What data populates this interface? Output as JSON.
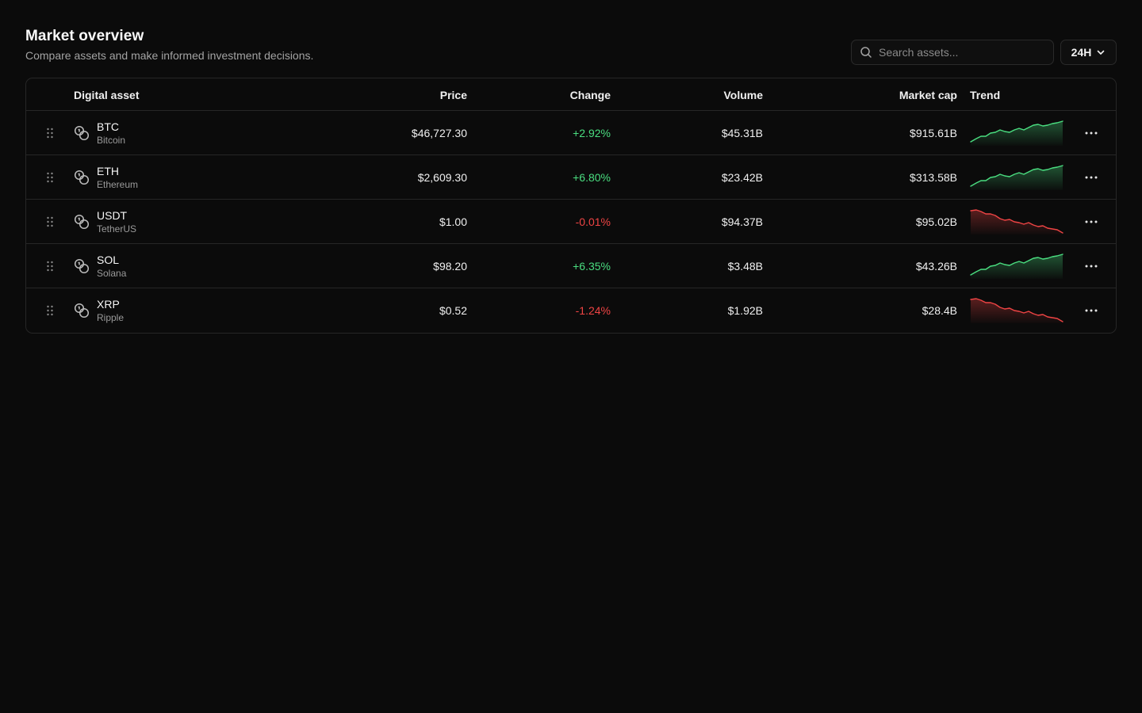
{
  "header": {
    "title": "Market overview",
    "subtitle": "Compare assets and make informed investment decisions."
  },
  "search": {
    "placeholder": "Search assets..."
  },
  "period": {
    "selected": "24H"
  },
  "table": {
    "columns": {
      "asset": "Digital asset",
      "price": "Price",
      "change": "Change",
      "volume": "Volume",
      "market_cap": "Market cap",
      "trend": "Trend"
    },
    "rows": [
      {
        "symbol": "BTC",
        "name": "Bitcoin",
        "price": "$46,727.30",
        "change": "+2.92%",
        "direction": "up",
        "volume": "$45.31B",
        "market_cap": "$915.61B"
      },
      {
        "symbol": "ETH",
        "name": "Ethereum",
        "price": "$2,609.30",
        "change": "+6.80%",
        "direction": "up",
        "volume": "$23.42B",
        "market_cap": "$313.58B"
      },
      {
        "symbol": "USDT",
        "name": "TetherUS",
        "price": "$1.00",
        "change": "-0.01%",
        "direction": "down",
        "volume": "$94.37B",
        "market_cap": "$95.02B"
      },
      {
        "symbol": "SOL",
        "name": "Solana",
        "price": "$98.20",
        "change": "+6.35%",
        "direction": "up",
        "volume": "$3.48B",
        "market_cap": "$43.26B"
      },
      {
        "symbol": "XRP",
        "name": "Ripple",
        "price": "$0.52",
        "change": "-1.24%",
        "direction": "down",
        "volume": "$1.92B",
        "market_cap": "$28.4B"
      }
    ]
  },
  "icons": {
    "search": "search-icon",
    "chevron": "chevron-down-icon",
    "drag": "drag-handle-icon",
    "coins": "coins-icon",
    "more": "more-horizontal-icon"
  },
  "colors": {
    "background": "#0b0b0b",
    "border": "#262626",
    "positive": "#4ade80",
    "negative": "#ef4444",
    "muted": "#9a9a9a"
  }
}
